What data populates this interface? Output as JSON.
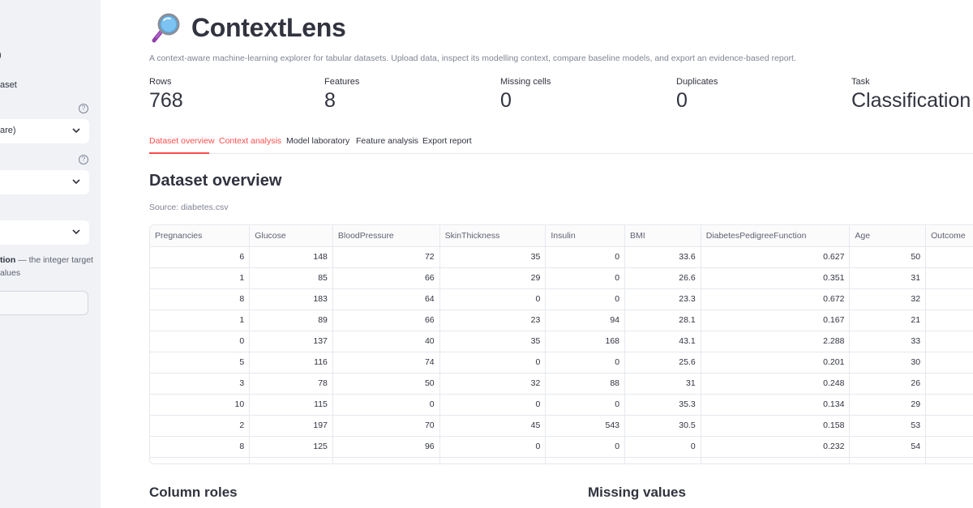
{
  "sidebar": {
    "frag_top": ")",
    "frag_dataset": "aset",
    "select1_value": "are)",
    "select2_value": "",
    "select3_value": "",
    "caption_bold": "tion",
    "caption_rest": " — the integer target",
    "caption_line2": "alues",
    "input_value": ""
  },
  "app": {
    "title": "ContextLens",
    "subtitle": "A context-aware machine-learning explorer for tabular datasets. Upload data, inspect its modelling context, compare baseline models, and export an evidence-based report."
  },
  "metrics": [
    {
      "label": "Rows",
      "value": "768"
    },
    {
      "label": "Features",
      "value": "8"
    },
    {
      "label": "Missing cells",
      "value": "0"
    },
    {
      "label": "Duplicates",
      "value": "0"
    },
    {
      "label": "Task",
      "value": "Classification"
    }
  ],
  "tabs": [
    {
      "label": "Dataset overview"
    },
    {
      "label": "Context analysis"
    },
    {
      "label": "Model laboratory"
    },
    {
      "label": "Feature analysis"
    },
    {
      "label": "Export report"
    }
  ],
  "overview": {
    "title": "Dataset overview",
    "source": "Source: diabetes.csv"
  },
  "table": {
    "columns": [
      "Pregnancies",
      "Glucose",
      "BloodPressure",
      "SkinThickness",
      "Insulin",
      "BMI",
      "DiabetesPedigreeFunction",
      "Age",
      "Outcome"
    ],
    "rows": [
      [
        "6",
        "148",
        "72",
        "35",
        "0",
        "33.6",
        "0.627",
        "50",
        ""
      ],
      [
        "1",
        "85",
        "66",
        "29",
        "0",
        "26.6",
        "0.351",
        "31",
        ""
      ],
      [
        "8",
        "183",
        "64",
        "0",
        "0",
        "23.3",
        "0.672",
        "32",
        ""
      ],
      [
        "1",
        "89",
        "66",
        "23",
        "94",
        "28.1",
        "0.167",
        "21",
        ""
      ],
      [
        "0",
        "137",
        "40",
        "35",
        "168",
        "43.1",
        "2.288",
        "33",
        ""
      ],
      [
        "5",
        "116",
        "74",
        "0",
        "0",
        "25.6",
        "0.201",
        "30",
        ""
      ],
      [
        "3",
        "78",
        "50",
        "32",
        "88",
        "31",
        "0.248",
        "26",
        ""
      ],
      [
        "10",
        "115",
        "0",
        "0",
        "0",
        "35.3",
        "0.134",
        "29",
        ""
      ],
      [
        "2",
        "197",
        "70",
        "45",
        "543",
        "30.5",
        "0.158",
        "53",
        ""
      ],
      [
        "8",
        "125",
        "96",
        "0",
        "0",
        "0",
        "0.232",
        "54",
        ""
      ],
      [
        "",
        "",
        "",
        "",
        "",
        "",
        "",
        "",
        ""
      ]
    ]
  },
  "sections": {
    "column_roles": "Column roles",
    "missing_values": "Missing values"
  },
  "colors": {
    "accent": "#ff4b4b",
    "sidebar_bg": "#f0f2f6",
    "text": "#31333f",
    "muted": "#808495"
  },
  "icons": {
    "title": "magnifying-glass-icon",
    "help": "question-circle-icon",
    "select": "chevron-down-icon"
  }
}
